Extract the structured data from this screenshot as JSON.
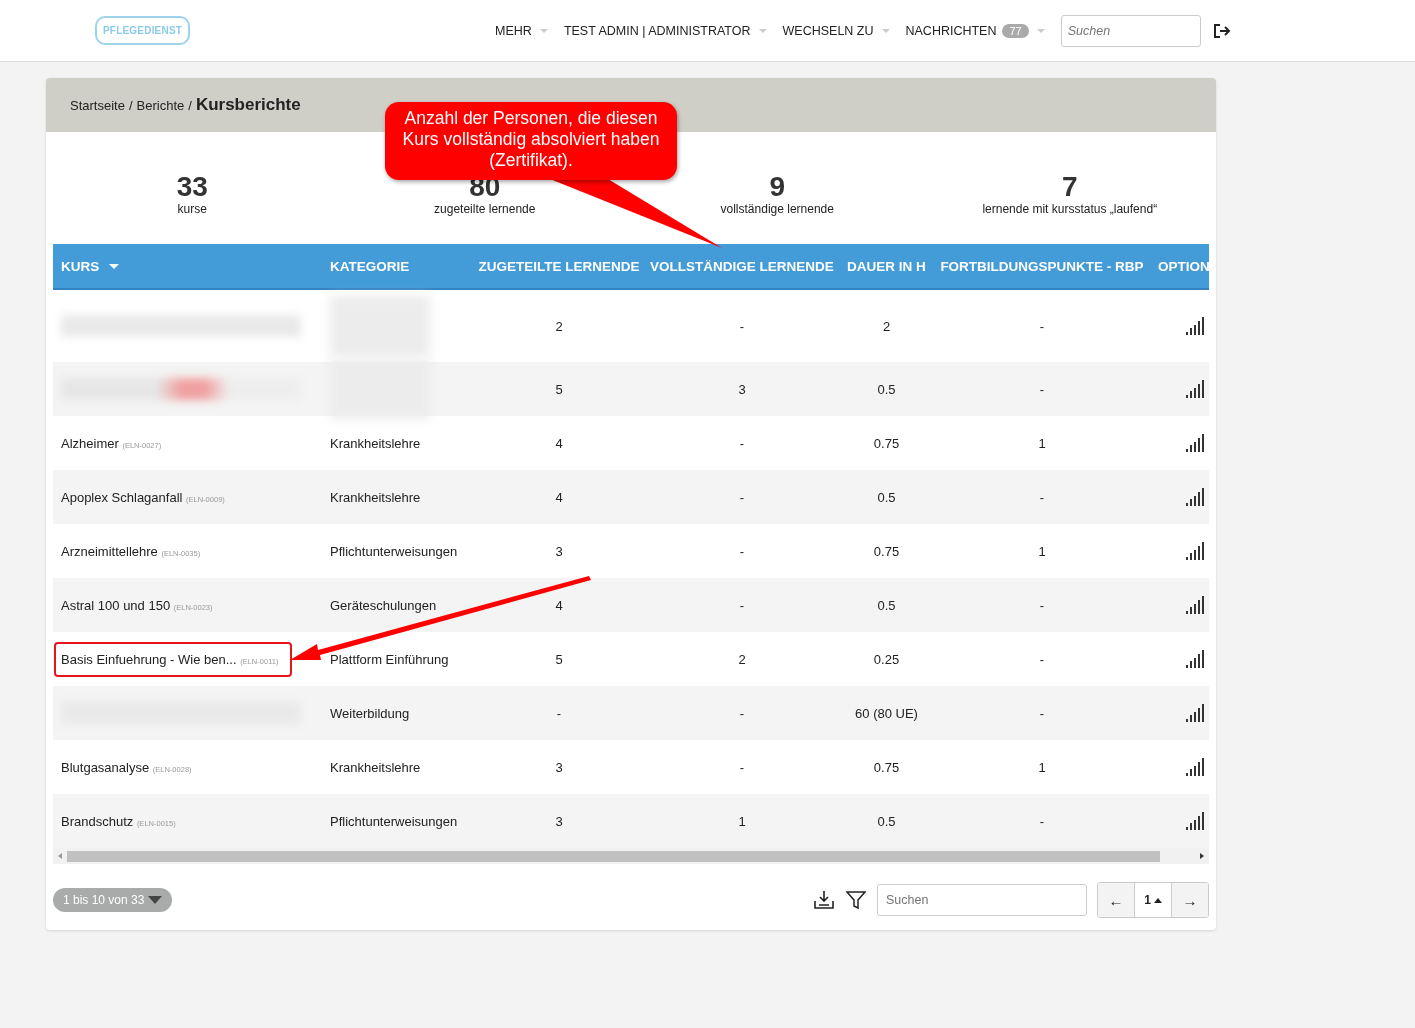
{
  "topbar": {
    "logo": "PFLEGEDIENST",
    "menu": [
      {
        "label": "MEHR",
        "kind": "dropdown"
      },
      {
        "label": "TEST ADMIN",
        "kind": "user",
        "separator": "|",
        "role": "ADMINISTRATOR"
      },
      {
        "label": "WECHSELN ZU",
        "kind": "dropdown"
      },
      {
        "label": "NACHRICHTEN",
        "kind": "messages",
        "badge": "77"
      }
    ],
    "search": {
      "placeholder": "Suchen"
    }
  },
  "breadcrumb": {
    "items": [
      "Startseite",
      "Berichte"
    ],
    "separator": "/",
    "current": "Kursberichte"
  },
  "stats": [
    {
      "value": "33",
      "label": "kurse"
    },
    {
      "value": "80",
      "label": "zugeteilte lernende"
    },
    {
      "value": "9",
      "label": "vollständige lernende"
    },
    {
      "value": "7",
      "label": "lernende mit kursstatus „laufend“"
    }
  ],
  "table": {
    "columns": [
      "KURS",
      "KATEGORIE",
      "ZUGETEILTE LERNENDE",
      "VOLLSTÄNDIGE LERNENDE",
      "DAUER IN H",
      "FORTBILDUNGSPUNKTE - RBP",
      "OPTION"
    ],
    "rows": [
      {
        "kind": "redacted",
        "assigned": "2",
        "complete": "-",
        "duration": "2",
        "points": "-",
        "highlighted": false
      },
      {
        "kind": "redacted",
        "assigned": "5",
        "complete": "3",
        "duration": "0.5",
        "points": "-",
        "highlighted": false
      },
      {
        "kind": "course",
        "name": "Alzheimer",
        "code": "(ELN-0027)",
        "category": "Krankheitslehre",
        "assigned": "4",
        "complete": "-",
        "duration": "0.75",
        "points": "1",
        "highlighted": false
      },
      {
        "kind": "course",
        "name": "Apoplex Schlaganfall",
        "code": "(ELN-0009)",
        "category": "Krankheitslehre",
        "assigned": "4",
        "complete": "-",
        "duration": "0.5",
        "points": "-",
        "highlighted": false
      },
      {
        "kind": "course",
        "name": "Arzneimittellehre",
        "code": "(ELN-0035)",
        "category": "Pflichtunterweisungen",
        "assigned": "3",
        "complete": "-",
        "duration": "0.75",
        "points": "1",
        "highlighted": false
      },
      {
        "kind": "course",
        "name": "Astral 100 und 150",
        "code": "(ELN-0023)",
        "category": "Geräteschulungen",
        "assigned": "4",
        "complete": "-",
        "duration": "0.5",
        "points": "-",
        "highlighted": false
      },
      {
        "kind": "course",
        "name": "Basis Einfuehrung - Wie ben...",
        "code": "(ELN-0011)",
        "category": "Plattform Einführung",
        "assigned": "5",
        "complete": "2",
        "duration": "0.25",
        "points": "-",
        "highlighted": true
      },
      {
        "kind": "redacted",
        "category": "Weiterbildung",
        "assigned": "-",
        "complete": "-",
        "duration": "60 (80 UE)",
        "points": "-",
        "highlighted": false
      },
      {
        "kind": "course",
        "name": "Blutgasanalyse",
        "code": "(ELN-0028)",
        "category": "Krankheitslehre",
        "assigned": "3",
        "complete": "-",
        "duration": "0.75",
        "points": "1",
        "highlighted": false
      },
      {
        "kind": "course",
        "name": "Brandschutz",
        "code": "(ELN-0015)",
        "category": "Pflichtunterweisungen",
        "assigned": "3",
        "complete": "1",
        "duration": "0.5",
        "points": "-",
        "highlighted": false
      }
    ]
  },
  "footer": {
    "page_info": "1 bis 10 von 33",
    "search": {
      "placeholder": "Suchen"
    },
    "pagination": {
      "prev": "←",
      "page": "1",
      "next": "→"
    }
  },
  "annotations": [
    {
      "kind": "callout",
      "text": "Anzahl der Personen, die diesen Kurs vollständig absolviert haben (Zertifikat)."
    },
    {
      "kind": "arrow"
    }
  ]
}
